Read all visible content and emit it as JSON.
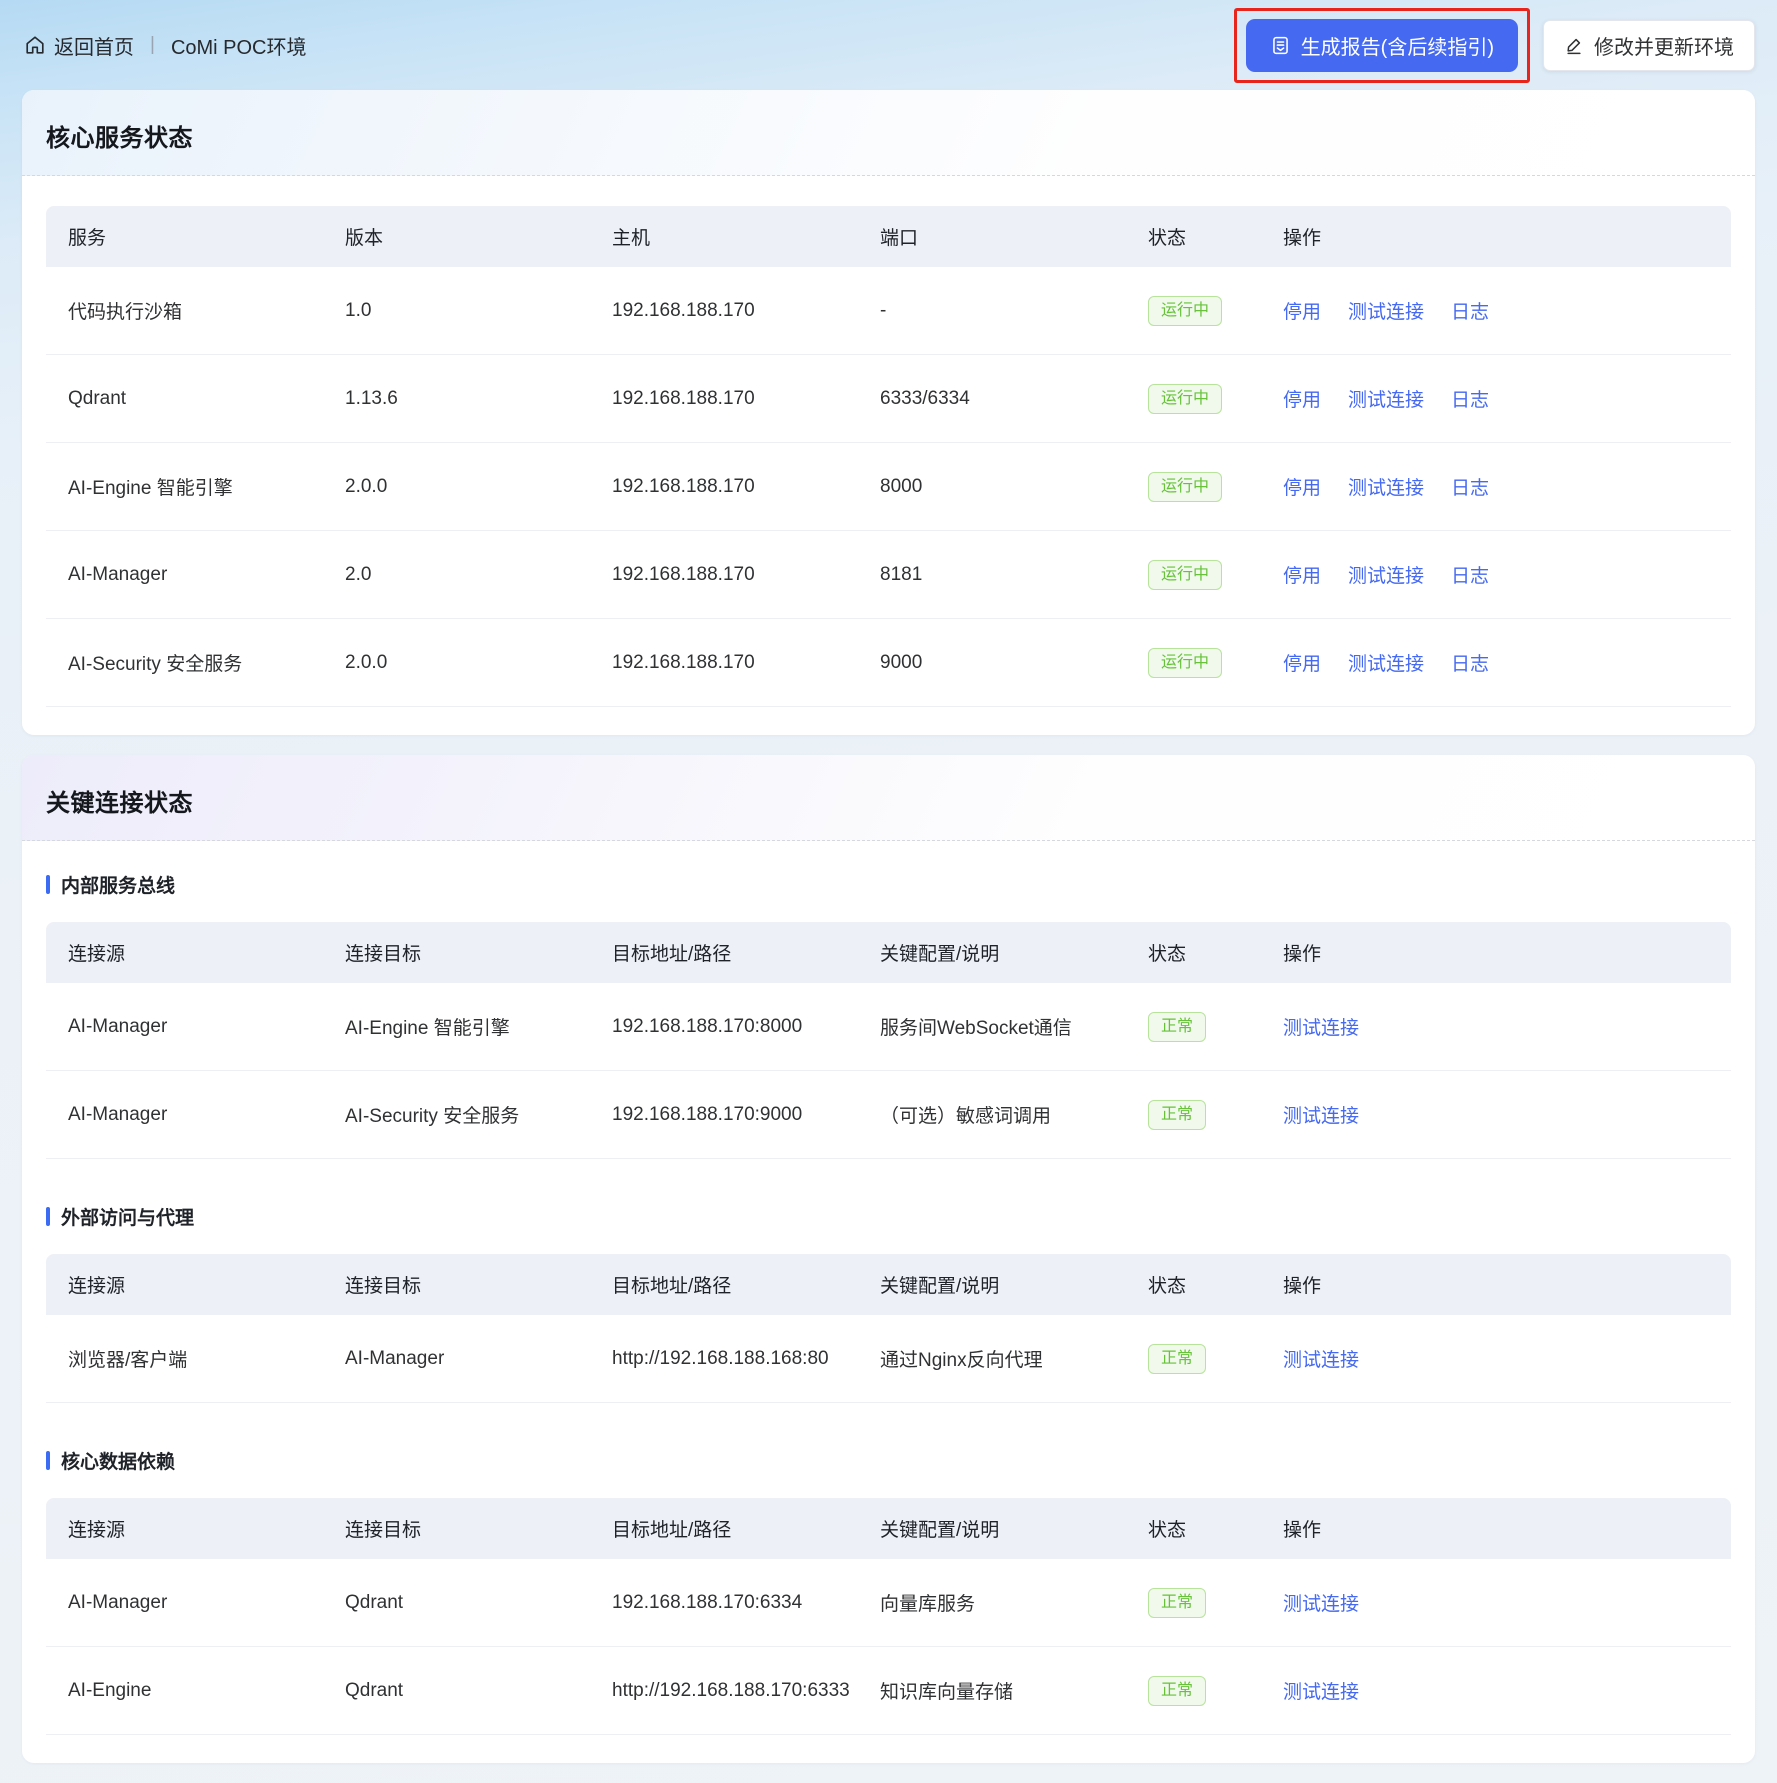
{
  "topbar": {
    "back_home": "返回首页",
    "separator": "|",
    "env_title": "CoMi POC环境",
    "generate_report_label": "生成报告(含后续指引)",
    "update_env_label": "修改并更新环境"
  },
  "icons": {
    "home": "home-icon",
    "report": "report-document-icon",
    "edit": "edit-pencil-icon"
  },
  "colors": {
    "primary_button": "#4569f0",
    "annotation_red": "#e8251d",
    "link_blue": "#4569f2",
    "status_green": "#67c23a",
    "status_green_bg": "#f0f9eb",
    "status_green_border": "#b7e39b",
    "table_header_bg": "#eef0f7",
    "section_bar_blue": "#3a6bf2"
  },
  "services_card": {
    "title": "核心服务状态",
    "columns": [
      "服务",
      "版本",
      "主机",
      "端口",
      "状态",
      "操作"
    ],
    "action_labels": {
      "stop": "停用",
      "test": "测试连接",
      "log": "日志"
    },
    "rows": [
      {
        "service": "代码执行沙箱",
        "version": "1.0",
        "host": "192.168.188.170",
        "port": "-",
        "status": "运行中"
      },
      {
        "service": "Qdrant",
        "version": "1.13.6",
        "host": "192.168.188.170",
        "port": "6333/6334",
        "status": "运行中"
      },
      {
        "service": "AI-Engine 智能引擎",
        "version": "2.0.0",
        "host": "192.168.188.170",
        "port": "8000",
        "status": "运行中"
      },
      {
        "service": "AI-Manager",
        "version": "2.0",
        "host": "192.168.188.170",
        "port": "8181",
        "status": "运行中"
      },
      {
        "service": "AI-Security 安全服务",
        "version": "2.0.0",
        "host": "192.168.188.170",
        "port": "9000",
        "status": "运行中"
      }
    ]
  },
  "connections_card": {
    "title": "关键连接状态",
    "columns": [
      "连接源",
      "连接目标",
      "目标地址/路径",
      "关键配置/说明",
      "状态",
      "操作"
    ],
    "test_label": "测试连接",
    "sections": [
      {
        "name": "内部服务总线",
        "rows": [
          {
            "source": "AI-Manager",
            "target": "AI-Engine 智能引擎",
            "address": "192.168.188.170:8000",
            "config": "服务间WebSocket通信",
            "status": "正常"
          },
          {
            "source": "AI-Manager",
            "target": "AI-Security 安全服务",
            "address": "192.168.188.170:9000",
            "config": "（可选）敏感词调用",
            "status": "正常"
          }
        ]
      },
      {
        "name": "外部访问与代理",
        "rows": [
          {
            "source": "浏览器/客户端",
            "target": "AI-Manager",
            "address": "http://192.168.188.168:80",
            "config": "通过Nginx反向代理",
            "status": "正常"
          }
        ]
      },
      {
        "name": "核心数据依赖",
        "rows": [
          {
            "source": "AI-Manager",
            "target": "Qdrant",
            "address": "192.168.188.170:6334",
            "config": "向量库服务",
            "status": "正常"
          },
          {
            "source": "AI-Engine",
            "target": "Qdrant",
            "address": "http://192.168.188.170:6333",
            "config": "知识库向量存储",
            "status": "正常"
          }
        ]
      }
    ]
  }
}
